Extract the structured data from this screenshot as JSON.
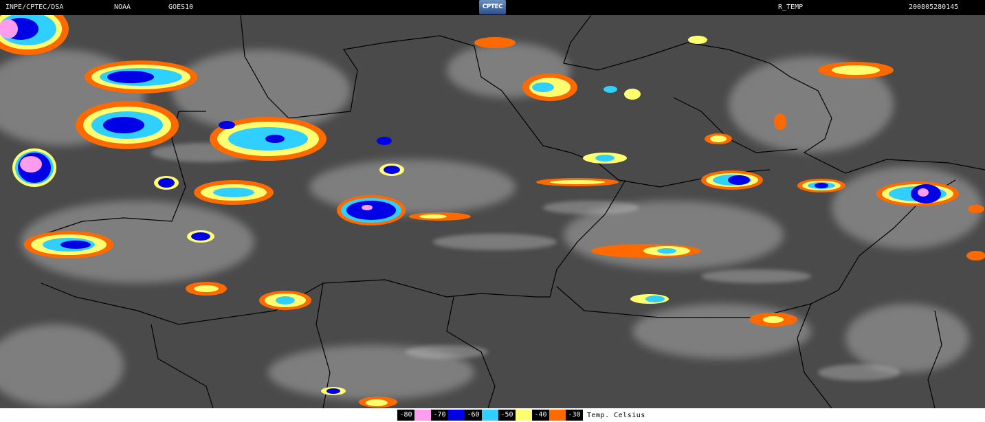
{
  "header": {
    "source": "INPE/CPTEC/DSA",
    "agency": "NOAA",
    "satellite": "GOES10",
    "logo_text": "CPTEC",
    "product": "R_TEMP",
    "timestamp": "200805280145"
  },
  "legend": {
    "items": [
      {
        "label": "-80",
        "color": "#ff9cf0"
      },
      {
        "label": "-70",
        "color": "#0000e6"
      },
      {
        "label": "-60",
        "color": "#2fd0ff"
      },
      {
        "label": "-50",
        "color": "#ffff70"
      },
      {
        "label": "-40",
        "color": "#ff6a00"
      },
      {
        "label": "-30",
        "color": "#4a4a4a"
      }
    ],
    "units": "Temp. Celsius"
  },
  "colors": {
    "background": "#4a4a4a",
    "cloud": "#d8d8d8",
    "border": "#000000"
  }
}
